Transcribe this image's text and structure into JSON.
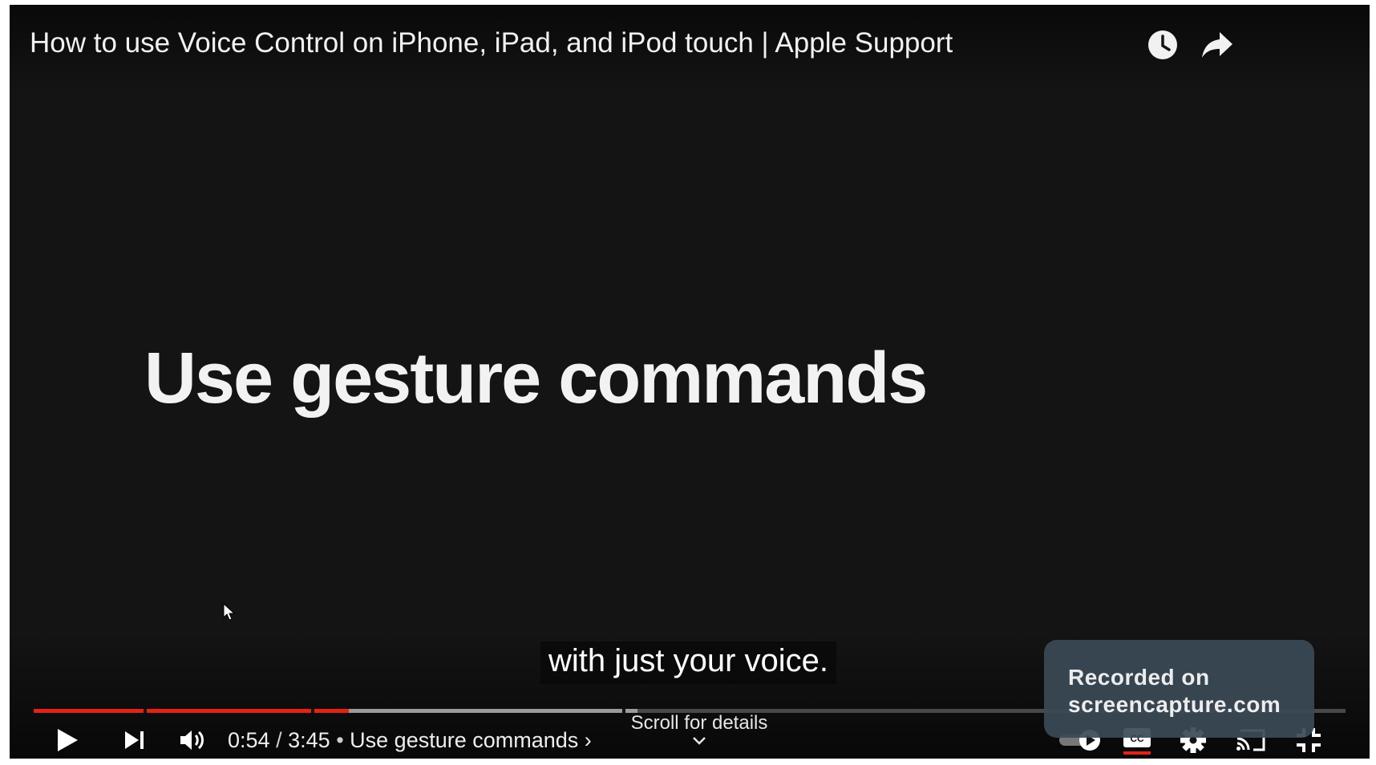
{
  "player": {
    "title": "How to use Voice Control on iPhone, iPad, and iPod touch | Apple Support",
    "slide_heading": "Use gesture commands",
    "caption": "with just your voice.",
    "time": {
      "current": "0:54",
      "separator": "/",
      "duration": "3:45",
      "chapter_bullet": "•",
      "chapter": "Use gesture commands",
      "chapter_arrow": "›"
    },
    "progress": {
      "played_fraction": 0.24,
      "buffered_fraction": 0.46,
      "chapter_marks": [
        0.085,
        0.213,
        0.45
      ]
    },
    "scroll_hint": "Scroll for details",
    "icons": {
      "watch_later": "clock-icon",
      "share": "share-arrow-icon",
      "play": "play-icon",
      "next": "skip-next-icon",
      "volume": "volume-icon",
      "autoplay": "autoplay-toggle-icon",
      "captions": "cc-icon",
      "settings": "gear-icon",
      "cast": "cast-icon",
      "exit_fullscreen": "exit-fullscreen-icon",
      "scroll": "chevron-down-icon"
    },
    "colors": {
      "progress_played": "#e62117",
      "captions_active_underline": "#e62117",
      "background": "#141414"
    }
  },
  "watermark": {
    "line1": "Recorded on",
    "line2": "screencapture.com"
  }
}
